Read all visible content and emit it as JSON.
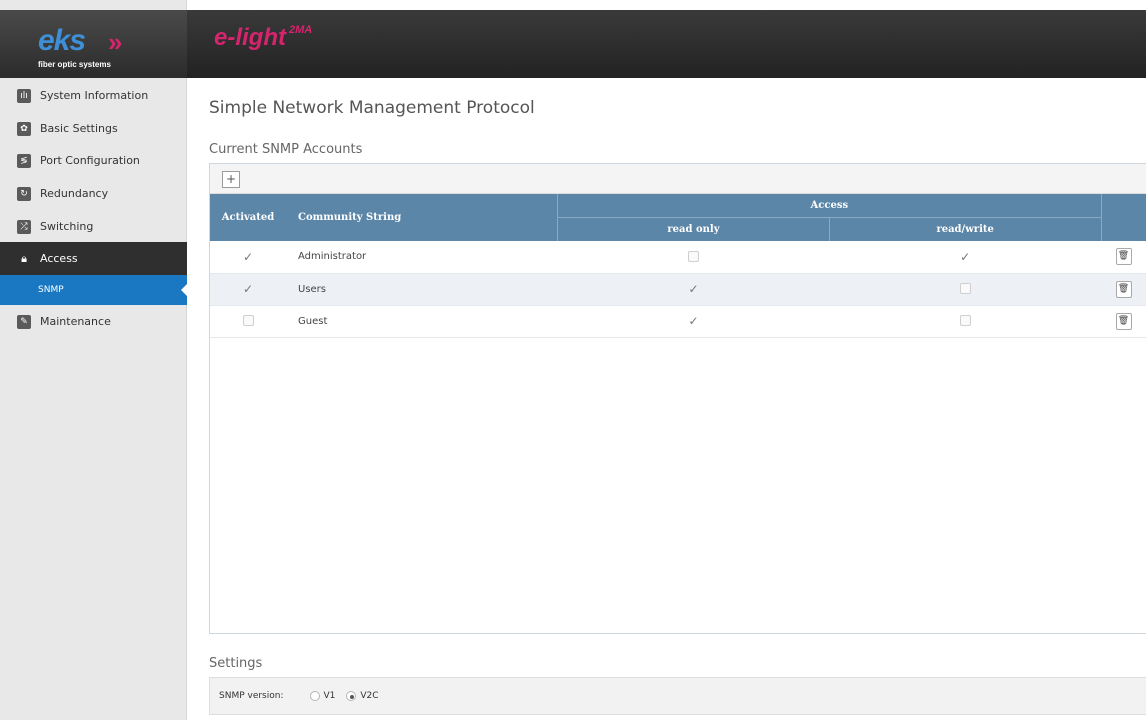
{
  "brand": {
    "logo_text": "eks",
    "logo_chevrons": "»",
    "logo_subtitle": "fiber optic systems",
    "product_name": "e-light",
    "product_sup": "2MA"
  },
  "sidebar": {
    "items": [
      {
        "label": "System Information",
        "icon": "bar-chart-icon"
      },
      {
        "label": "Basic Settings",
        "icon": "gear-icon"
      },
      {
        "label": "Port Configuration",
        "icon": "port-config-icon"
      },
      {
        "label": "Redundancy",
        "icon": "refresh-icon"
      },
      {
        "label": "Switching",
        "icon": "shuffle-icon"
      },
      {
        "label": "Access",
        "icon": "lock-icon"
      },
      {
        "label": "Maintenance",
        "icon": "wrench-icon"
      }
    ],
    "active_sub": "SNMP"
  },
  "page": {
    "title": "Simple Network Management Protocol",
    "accounts_section": "Current SNMP Accounts",
    "settings_section": "Settings"
  },
  "table": {
    "add_label": "+",
    "headers": {
      "activated": "Activated",
      "community": "Community String",
      "access": "Access",
      "read_only": "read only",
      "read_write": "read/write"
    },
    "rows": [
      {
        "activated": true,
        "community": "Administrator",
        "read_only": false,
        "read_write": true
      },
      {
        "activated": true,
        "community": "Users",
        "read_only": true,
        "read_write": false
      },
      {
        "activated": false,
        "community": "Guest",
        "read_only": true,
        "read_write": false
      }
    ]
  },
  "settings": {
    "snmp_version_label": "SNMP version:",
    "options": [
      "V1",
      "V2C"
    ],
    "selected": "V2C"
  },
  "colors": {
    "header_blue": "#5b86a8",
    "active_nav": "#2f2f2f",
    "sub_nav": "#1a78c2",
    "brand_pink": "#d6246e",
    "brand_blue": "#3e8fd6"
  }
}
